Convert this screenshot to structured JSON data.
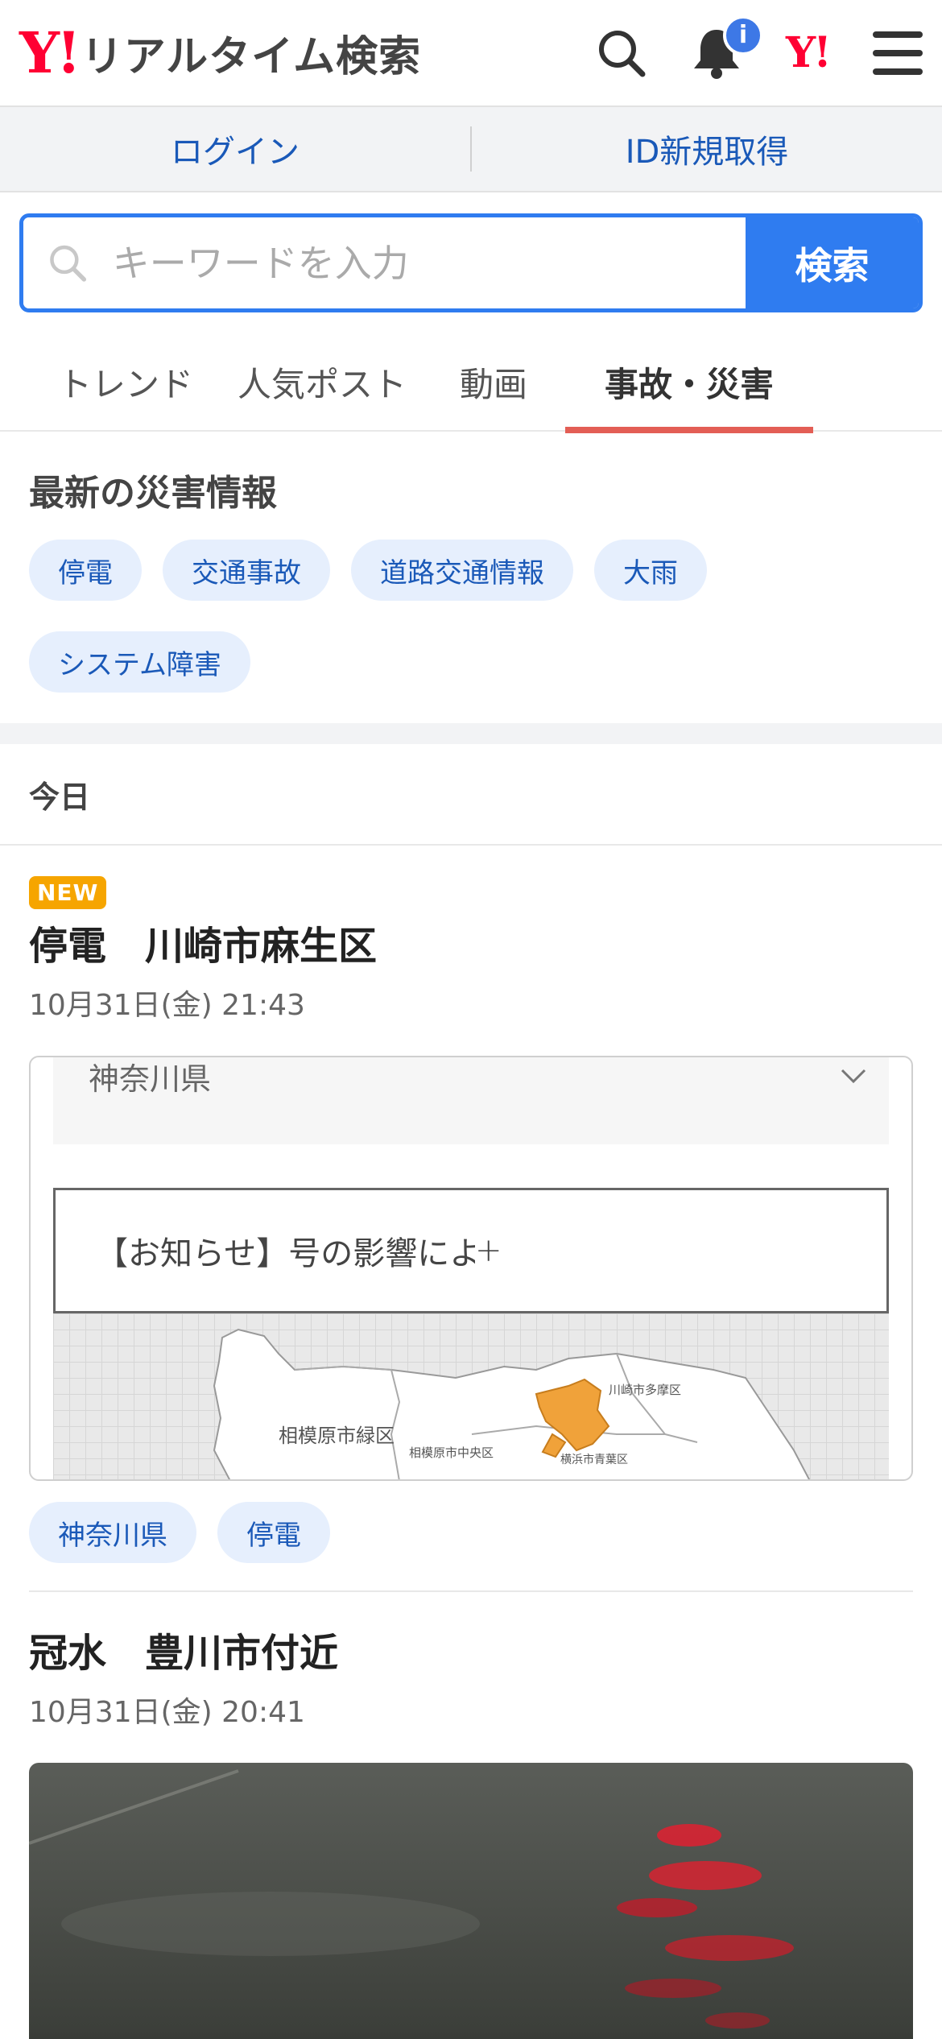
{
  "header": {
    "logo_y": "Y!",
    "logo_text": "リアルタイム検索",
    "notification_badge": "i",
    "yj_logo": "Y!",
    "icons": [
      "search-icon",
      "bell-icon",
      "yahoo-logo-icon",
      "menu-icon"
    ]
  },
  "login_bar": {
    "login": "ログイン",
    "register": "ID新規取得"
  },
  "search": {
    "placeholder": "キーワードを入力",
    "button": "検索"
  },
  "tabs": [
    {
      "label": "トレンド",
      "active": false
    },
    {
      "label": "人気ポスト",
      "active": false
    },
    {
      "label": "動画",
      "active": false
    },
    {
      "label": "事故・災害",
      "active": true
    }
  ],
  "disaster": {
    "heading": "最新の災害情報",
    "chips": [
      "停電",
      "交通事故",
      "道路交通情報",
      "大雨",
      "システム障害"
    ]
  },
  "today_label": "今日",
  "articles": [
    {
      "badge": "NEW",
      "title": "停電　川崎市麻生区",
      "date": "10月31日(金) 21:43",
      "map": {
        "select_value": "神奈川県",
        "notice": "【お知らせ】号の影響により、八丈島および青",
        "labels": [
          "相模原市緑区",
          "相模原市中央区",
          "川崎市多摩区",
          "横浜市青葉区"
        ],
        "highlight_color": "#f0a23a"
      },
      "tags": [
        "神奈川県",
        "停電"
      ]
    },
    {
      "title": "冠水　豊川市付近",
      "date": "10月31日(金) 20:41"
    }
  ],
  "colors": {
    "brand_red": "#ff0033",
    "accent_blue": "#2f7cf0",
    "link_blue": "#1a59b8",
    "active_tab_underline": "#e35e55",
    "new_badge": "#f6a500"
  }
}
